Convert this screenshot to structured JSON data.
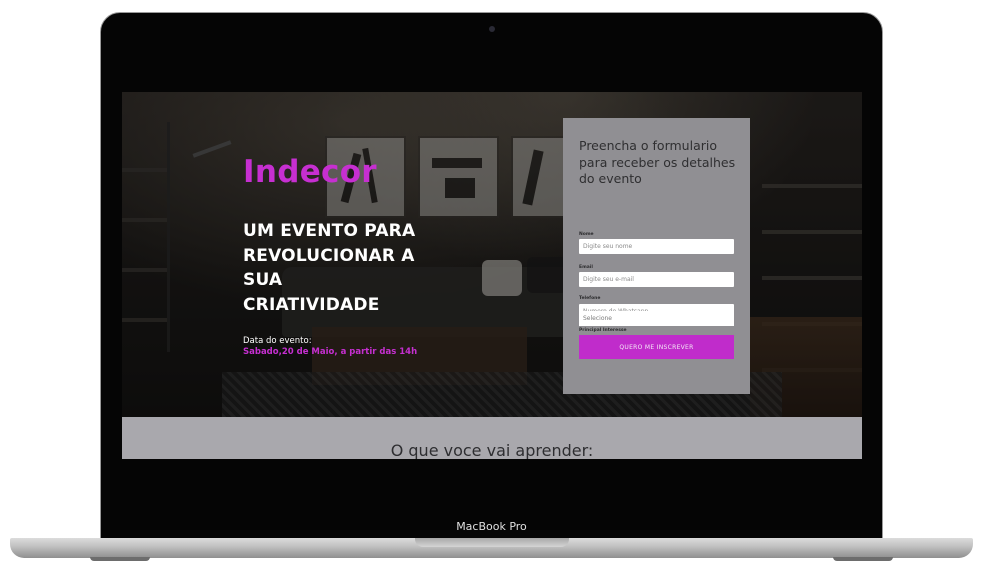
{
  "device": {
    "label": "MacBook Pro"
  },
  "hero": {
    "brand": "Indecor",
    "headline_lines": [
      "UM EVENTO PARA",
      "REVOLUCIONAR A",
      "SUA",
      "CRIATIVIDADE"
    ],
    "date_label": "Data do evento:",
    "date_value": "Sabado,20 de Maio, a partir das 14h"
  },
  "form": {
    "title": "Preencha o formulario para receber os detalhes do evento",
    "fields": [
      {
        "label": "Nome",
        "placeholder": "Digite seu nome"
      },
      {
        "label": "Email",
        "placeholder": "Digite seu e-mail"
      },
      {
        "label": "Telefone",
        "placeholder": "Numero de Whatsapp"
      },
      {
        "label": "Principal Interesse",
        "selected": "Selecione"
      }
    ],
    "submit_label": "QUERO ME INSCREVER"
  },
  "section": {
    "title": "O que voce vai aprender:"
  },
  "colors": {
    "accent": "#c62fd1",
    "form_bg": "#908f93",
    "section_bg": "#a9a8ad"
  }
}
